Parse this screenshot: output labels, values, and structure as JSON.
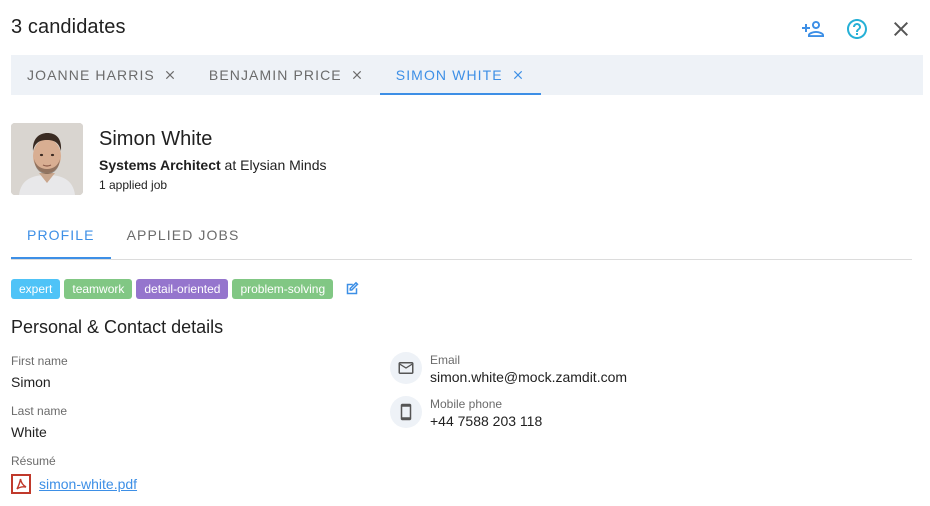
{
  "header": {
    "title": "3 candidates"
  },
  "candidate_tabs": [
    {
      "label": "JOANNE HARRIS",
      "active": false
    },
    {
      "label": "BENJAMIN PRICE",
      "active": false
    },
    {
      "label": "SIMON WHITE",
      "active": true
    }
  ],
  "profile": {
    "name": "Simon White",
    "title": "Systems Architect",
    "at": "at",
    "company": "Elysian Minds",
    "applied": "1 applied job"
  },
  "section_tabs": [
    {
      "label": "PROFILE",
      "active": true
    },
    {
      "label": "APPLIED JOBS",
      "active": false
    }
  ],
  "tags": [
    {
      "label": "expert",
      "color": "#4fc3f7"
    },
    {
      "label": "teamwork",
      "color": "#81c784"
    },
    {
      "label": "detail-oriented",
      "color": "#9575cd"
    },
    {
      "label": "problem-solving",
      "color": "#81c784"
    }
  ],
  "details": {
    "title": "Personal & Contact details",
    "first_name_label": "First name",
    "first_name": "Simon",
    "last_name_label": "Last name",
    "last_name": "White",
    "resume_label": "Résumé",
    "resume_file": "simon-white.pdf",
    "email_label": "Email",
    "email": "simon.white@mock.zamdit.com",
    "phone_label": "Mobile phone",
    "phone": "+44 7588 203 118"
  },
  "colors": {
    "accent": "#3d8fe6",
    "tab_bg": "#eef2f7",
    "pdf": "#c0392b"
  },
  "icons": [
    "add-user-icon",
    "help-icon",
    "close-icon",
    "edit-icon",
    "mail-icon",
    "phone-icon",
    "pdf-icon"
  ]
}
